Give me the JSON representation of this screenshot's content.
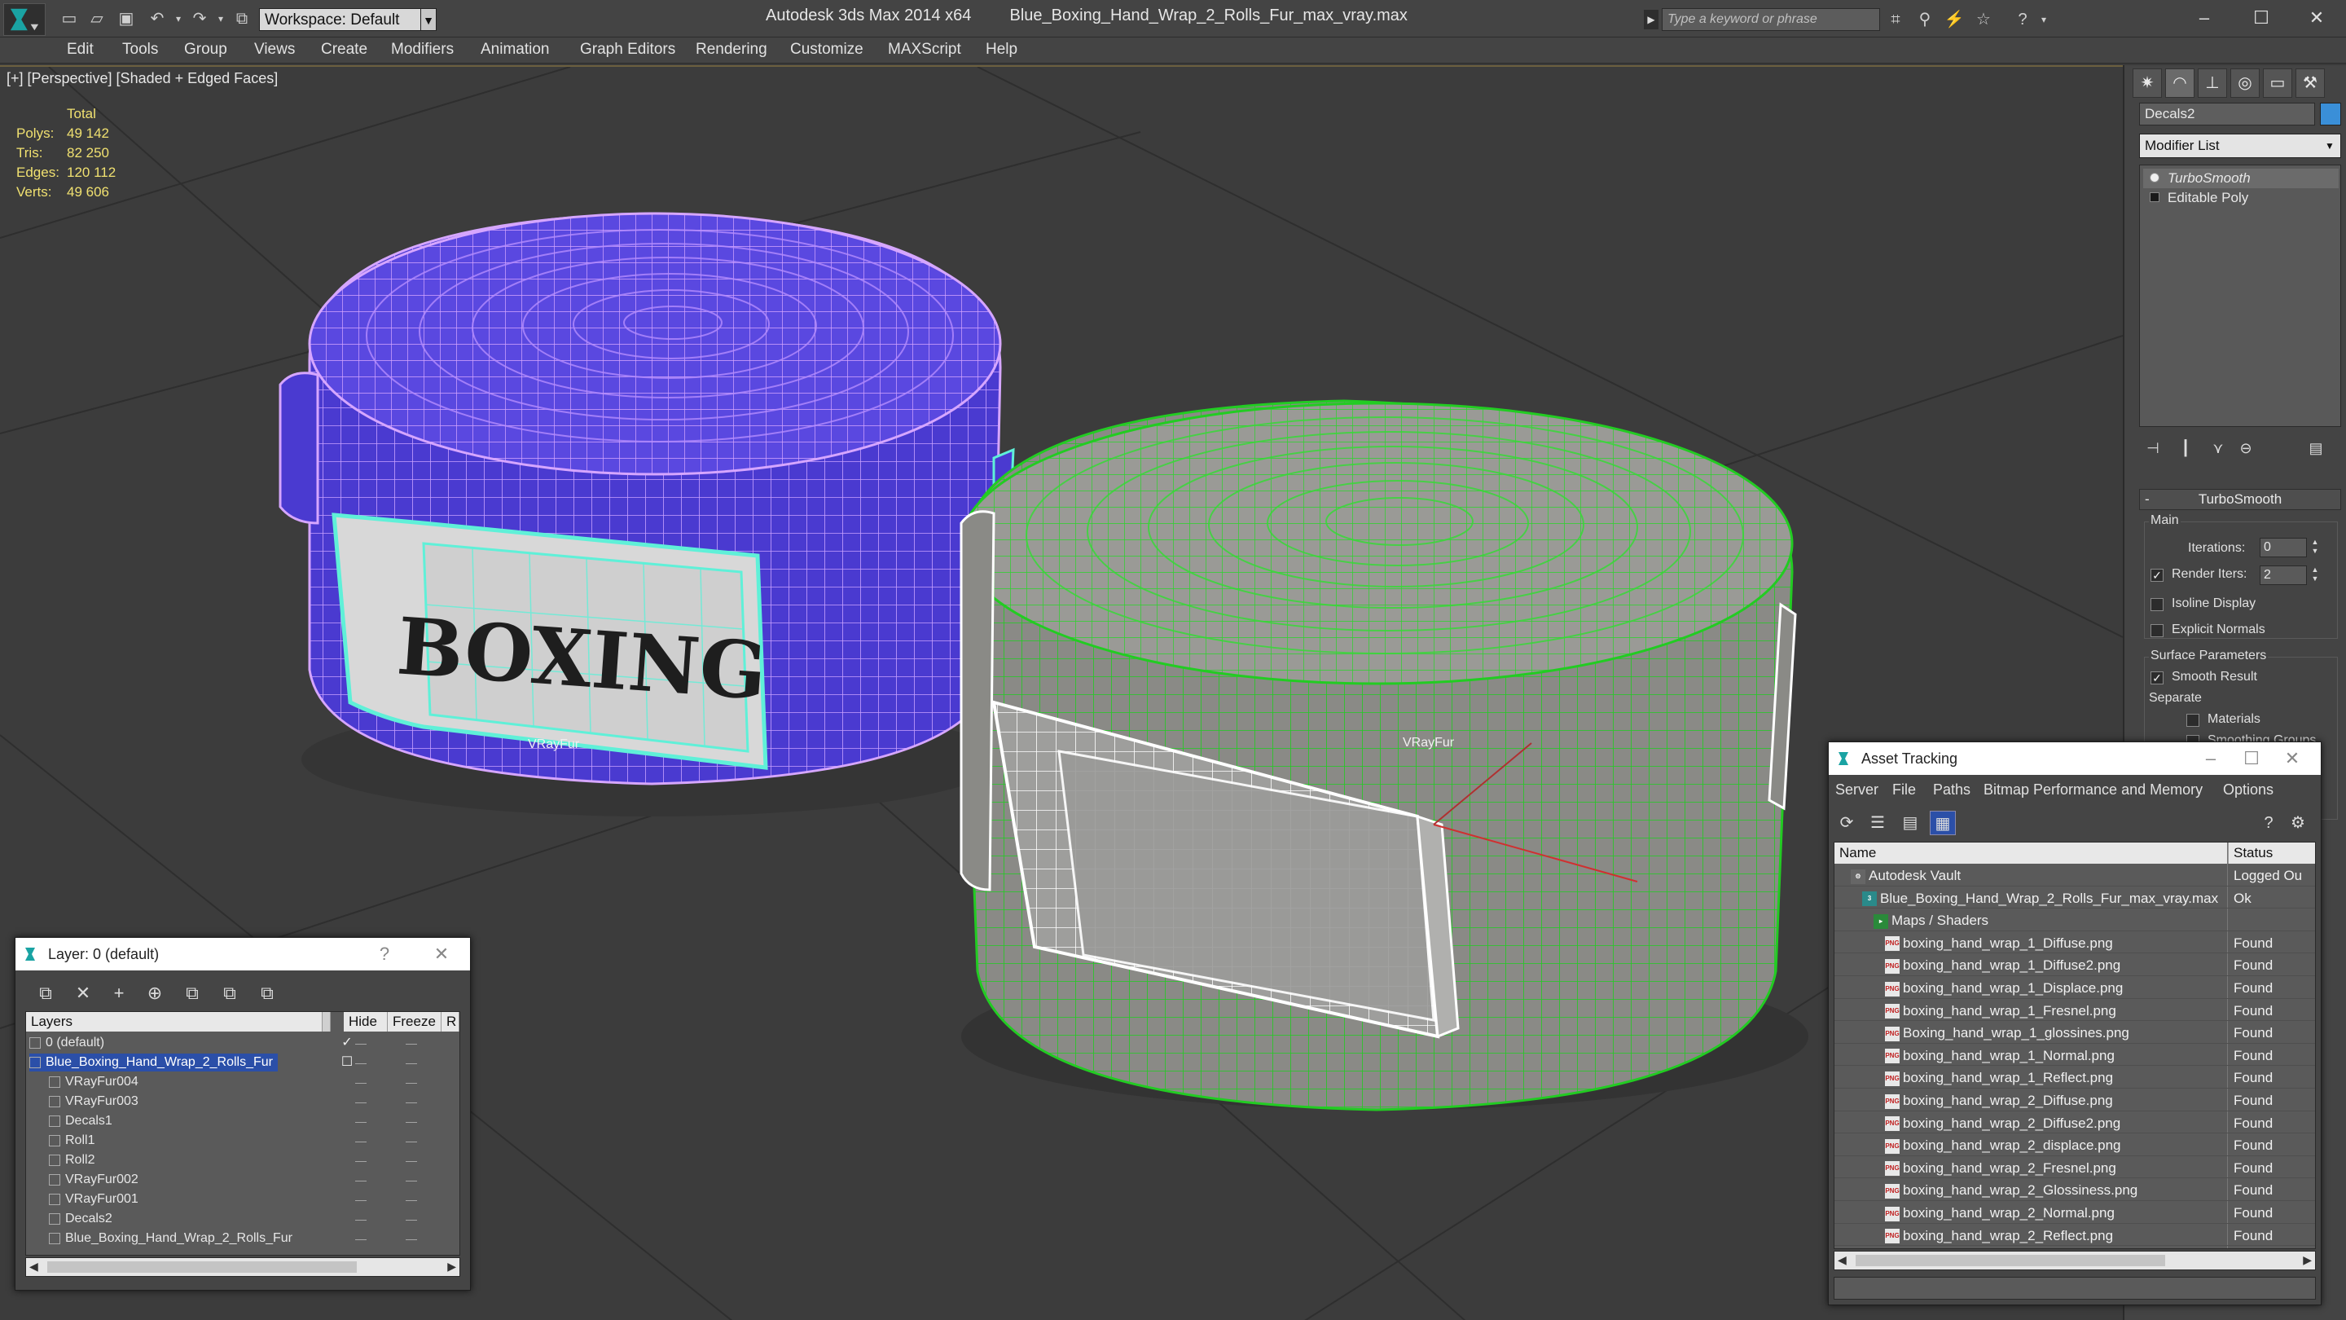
{
  "titlebar": {
    "app_title": "Autodesk 3ds Max  2014 x64",
    "file_name": "Blue_Boxing_Hand_Wrap_2_Rolls_Fur_max_vray.max",
    "workspace": "Workspace: Default",
    "search_placeholder": "Type a keyword or phrase"
  },
  "menubar": [
    "Edit",
    "Tools",
    "Group",
    "Views",
    "Create",
    "Modifiers",
    "Animation",
    "Graph Editors",
    "Rendering",
    "Customize",
    "MAXScript",
    "Help"
  ],
  "viewport": {
    "label": "[+] [Perspective] [Shaded + Edged Faces]",
    "stats": {
      "header": "Total",
      "rows": [
        {
          "label": "Polys:",
          "value": "49 142"
        },
        {
          "label": "Tris:",
          "value": "82 250"
        },
        {
          "label": "Edges:",
          "value": "120 112"
        },
        {
          "label": "Verts:",
          "value": "49 606"
        }
      ]
    },
    "object_labels": {
      "blue": "VRayFur",
      "green": "VRayFur"
    },
    "logo_text": "BOXING",
    "colors": {
      "blue_roll": "#4a3ad0",
      "green_roll": "#8a8a86",
      "green_wire": "#22cc22",
      "blue_wire": "#d6a6ff",
      "selection": "#5ff0d8"
    }
  },
  "command_panel": {
    "object_name": "Decals2",
    "object_color": "#3a8fd8",
    "modifier_list": "Modifier List",
    "stack": [
      "TurboSmooth",
      "Editable Poly"
    ],
    "turbosmooth": {
      "title": "TurboSmooth",
      "main_label": "Main",
      "iterations_label": "Iterations:",
      "iterations_value": "0",
      "render_iters_label": "Render Iters:",
      "render_iters_value": "2",
      "isoline_label": "Isoline Display",
      "explicit_normals_label": "Explicit Normals",
      "surface_params_label": "Surface Parameters",
      "smooth_result_label": "Smooth Result",
      "separate_label": "Separate",
      "materials_label": "Materials",
      "smoothing_groups_label": "Smoothing Groups"
    }
  },
  "layer_window": {
    "title": "Layer: 0 (default)",
    "columns": [
      "Layers",
      "Hide",
      "Freeze",
      "R"
    ],
    "rows": [
      {
        "name": "0 (default)",
        "indent": 1,
        "selected": false,
        "current": true
      },
      {
        "name": "Blue_Boxing_Hand_Wrap_2_Rolls_Fur",
        "indent": 1,
        "selected": true,
        "current": false
      },
      {
        "name": "VRayFur004",
        "indent": 2,
        "selected": false,
        "current": false
      },
      {
        "name": "VRayFur003",
        "indent": 2,
        "selected": false,
        "current": false
      },
      {
        "name": "Decals1",
        "indent": 2,
        "selected": false,
        "current": false
      },
      {
        "name": "Roll1",
        "indent": 2,
        "selected": false,
        "current": false
      },
      {
        "name": "Roll2",
        "indent": 2,
        "selected": false,
        "current": false
      },
      {
        "name": "VRayFur002",
        "indent": 2,
        "selected": false,
        "current": false
      },
      {
        "name": "VRayFur001",
        "indent": 2,
        "selected": false,
        "current": false
      },
      {
        "name": "Decals2",
        "indent": 2,
        "selected": false,
        "current": false
      },
      {
        "name": "Blue_Boxing_Hand_Wrap_2_Rolls_Fur",
        "indent": 2,
        "selected": false,
        "current": false
      }
    ]
  },
  "asset_window": {
    "title": "Asset Tracking",
    "menu": [
      "Server",
      "File",
      "Paths",
      "Bitmap Performance and Memory",
      "Options"
    ],
    "columns": [
      "Name",
      "Status"
    ],
    "rows": [
      {
        "name": "Autodesk Vault",
        "status": "Logged Ou",
        "indent": 1,
        "icon": "vault"
      },
      {
        "name": "Blue_Boxing_Hand_Wrap_2_Rolls_Fur_max_vray.max",
        "status": "Ok",
        "indent": 2,
        "icon": "max"
      },
      {
        "name": "Maps / Shaders",
        "status": "",
        "indent": 3,
        "icon": "maps"
      },
      {
        "name": "boxing_hand_wrap_1_Diffuse.png",
        "status": "Found",
        "indent": 4,
        "icon": "png"
      },
      {
        "name": "boxing_hand_wrap_1_Diffuse2.png",
        "status": "Found",
        "indent": 4,
        "icon": "png"
      },
      {
        "name": "boxing_hand_wrap_1_Displace.png",
        "status": "Found",
        "indent": 4,
        "icon": "png"
      },
      {
        "name": "boxing_hand_wrap_1_Fresnel.png",
        "status": "Found",
        "indent": 4,
        "icon": "png"
      },
      {
        "name": "Boxing_hand_wrap_1_glossines.png",
        "status": "Found",
        "indent": 4,
        "icon": "png"
      },
      {
        "name": "boxing_hand_wrap_1_Normal.png",
        "status": "Found",
        "indent": 4,
        "icon": "png"
      },
      {
        "name": "boxing_hand_wrap_1_Reflect.png",
        "status": "Found",
        "indent": 4,
        "icon": "png"
      },
      {
        "name": "boxing_hand_wrap_2_Diffuse.png",
        "status": "Found",
        "indent": 4,
        "icon": "png"
      },
      {
        "name": "boxing_hand_wrap_2_Diffuse2.png",
        "status": "Found",
        "indent": 4,
        "icon": "png"
      },
      {
        "name": "boxing_hand_wrap_2_displace.png",
        "status": "Found",
        "indent": 4,
        "icon": "png"
      },
      {
        "name": "boxing_hand_wrap_2_Fresnel.png",
        "status": "Found",
        "indent": 4,
        "icon": "png"
      },
      {
        "name": "boxing_hand_wrap_2_Glossiness.png",
        "status": "Found",
        "indent": 4,
        "icon": "png"
      },
      {
        "name": "boxing_hand_wrap_2_Normal.png",
        "status": "Found",
        "indent": 4,
        "icon": "png"
      },
      {
        "name": "boxing_hand_wrap_2_Reflect.png",
        "status": "Found",
        "indent": 4,
        "icon": "png"
      }
    ]
  }
}
